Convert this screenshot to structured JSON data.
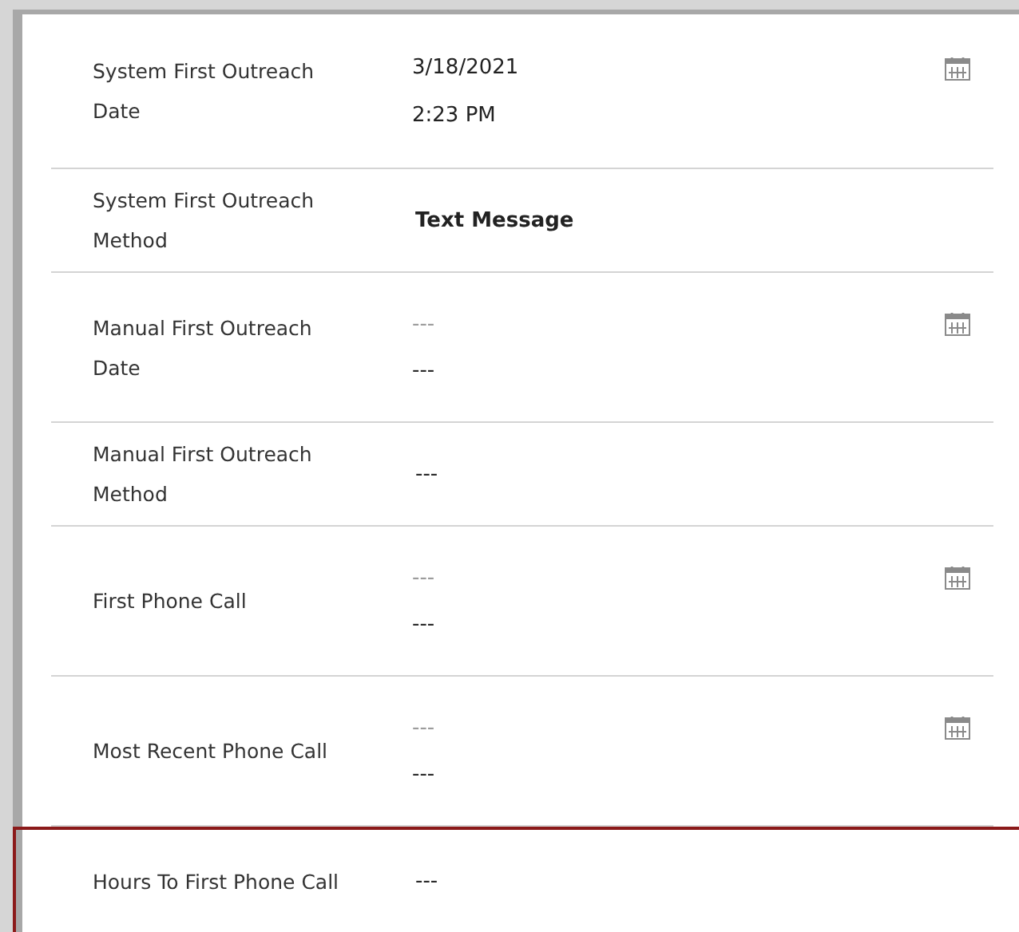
{
  "fields": [
    {
      "kind": "datetime",
      "label": "System First Outreach Date",
      "date": {
        "value": "3/18/2021"
      },
      "time": "2:23 PM",
      "selected": false
    },
    {
      "kind": "text",
      "label": "System First Outreach Method",
      "value": "Text Message",
      "bold": true,
      "selected": false
    },
    {
      "kind": "datetime",
      "label": "Manual First Outreach Date",
      "date": {
        "placeholder": "---"
      },
      "time": "---",
      "selected": false
    },
    {
      "kind": "text",
      "label": "Manual First Outreach Method",
      "value": "---",
      "bold": false,
      "selected": false
    },
    {
      "kind": "datetime",
      "label": "First Phone Call",
      "date": {
        "placeholder": "---"
      },
      "time": "---",
      "selected": false
    },
    {
      "kind": "datetime",
      "label": "Most Recent Phone Call",
      "date": {
        "placeholder": "---"
      },
      "time": "---",
      "selected": false
    },
    {
      "kind": "text",
      "label": "Hours To First Phone Call",
      "value": "---",
      "bold": false,
      "selected": true
    }
  ]
}
